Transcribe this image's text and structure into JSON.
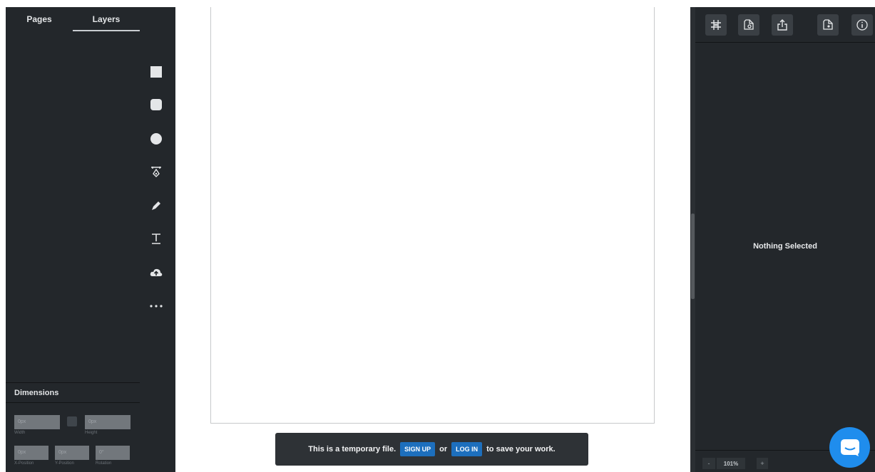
{
  "left_panel": {
    "tabs": [
      "Pages",
      "Layers"
    ],
    "active_tab": "Layers",
    "dimensions": {
      "header": "Dimensions",
      "width": {
        "value": "0px",
        "label": "Width"
      },
      "height": {
        "value": "0px",
        "label": "Height"
      },
      "x_position": {
        "value": "0px",
        "label": "X-Position"
      },
      "y_position": {
        "value": "0px",
        "label": "Y-Position"
      },
      "rotation": {
        "value": "0°",
        "label": "Rotation"
      }
    }
  },
  "tools": [
    "rectangle-icon",
    "rounded-rectangle-icon",
    "ellipse-icon",
    "pen-icon",
    "pencil-icon",
    "text-icon",
    "upload-icon",
    "more-icon"
  ],
  "banner": {
    "text_before": "This is a temporary file.",
    "signup": "SIGN UP",
    "or": "or",
    "login": "LOG IN",
    "text_after": "to save your work."
  },
  "right_panel": {
    "toolbar_icons": [
      "grid-icon",
      "export-image-icon",
      "share-icon",
      "export-code-icon",
      "info-icon"
    ],
    "empty_state": "Nothing Selected",
    "zoom": {
      "minus": "-",
      "value": "101%",
      "plus": "+"
    }
  },
  "colors": {
    "panel_bg": "#23272b",
    "accent": "#1d6fbd",
    "chat": "#1f8ded"
  }
}
